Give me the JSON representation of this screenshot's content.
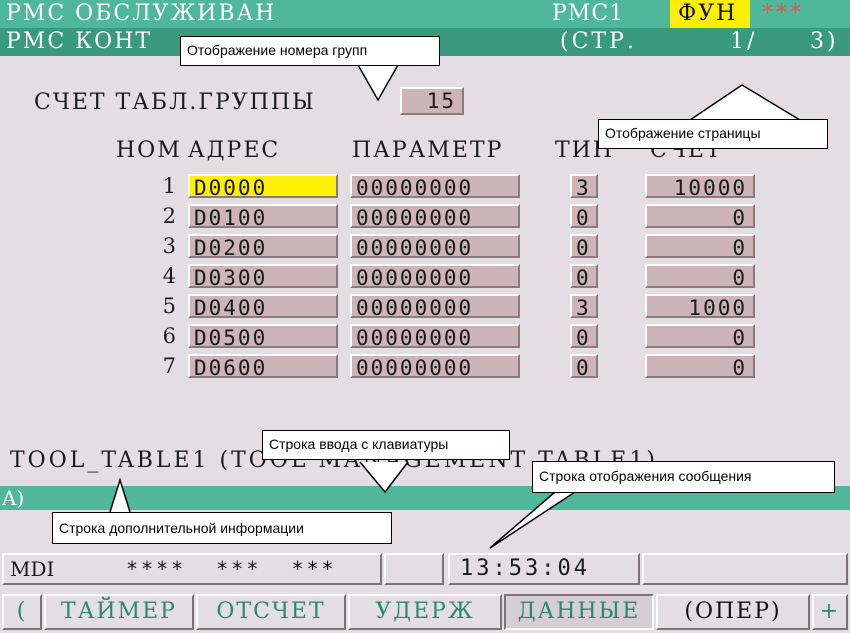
{
  "header": {
    "left_title": "PMC ОБСЛУЖИВАН",
    "pmc_label": "PMC1",
    "fun_label": "ФУН",
    "stars": "***"
  },
  "subheader": {
    "left_title": "PMC КОНТ",
    "page_label": "(СТР.",
    "page_current": "1/",
    "page_total": "3)"
  },
  "group_count": {
    "label": "СЧЕТ ТАБЛ.ГРУППЫ",
    "value": "15"
  },
  "table": {
    "headers": {
      "num": "НОМ",
      "address": "АДРЕС",
      "param": "ПАРАМЕТР",
      "type": "ТИП",
      "count": "СЧЕТ"
    },
    "rows": [
      {
        "num": "1",
        "address": "D0000",
        "param": "00000000",
        "type": "3",
        "count": "10000"
      },
      {
        "num": "2",
        "address": "D0100",
        "param": "00000000",
        "type": "0",
        "count": "0"
      },
      {
        "num": "3",
        "address": "D0200",
        "param": "00000000",
        "type": "0",
        "count": "0"
      },
      {
        "num": "4",
        "address": "D0300",
        "param": "00000000",
        "type": "0",
        "count": "0"
      },
      {
        "num": "5",
        "address": "D0400",
        "param": "00000000",
        "type": "3",
        "count": "1000"
      },
      {
        "num": "6",
        "address": "D0500",
        "param": "00000000",
        "type": "0",
        "count": "0"
      },
      {
        "num": "7",
        "address": "D0600",
        "param": "00000000",
        "type": "0",
        "count": "0"
      }
    ]
  },
  "info_line": "TOOL_TABLE1  (TOOL MANAGEMENT TABLE1)",
  "input_line": "A)",
  "status": {
    "mode": "MDI",
    "flags": "****  ***  ***",
    "time": "13:53:04"
  },
  "softkeys": {
    "left_arrow": "(",
    "timer": "ТАЙМЕР",
    "counter": "ОТСЧЕТ",
    "keep": "УДЕРЖ",
    "data": "ДАННЫЕ",
    "oper": "(ОПЕР)",
    "plus": "+"
  },
  "callouts": {
    "group_number": "Отображение номера групп",
    "page": "Отображение страницы",
    "keyboard_input": "Строка ввода с клавиатуры",
    "message": "Строка отображения сообщения",
    "extra_info": "Строка дополнительной информации"
  }
}
